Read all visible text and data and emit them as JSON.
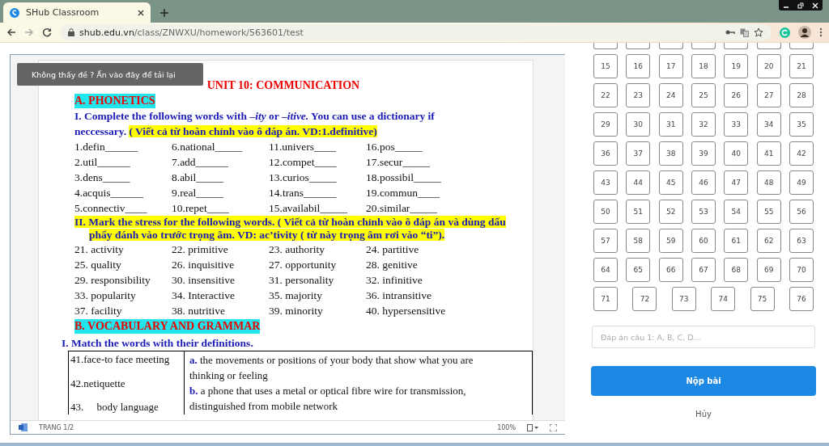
{
  "browser": {
    "tab_title": "SHub Classroom",
    "url_domain": "shub.edu.vn",
    "url_path": "/class/ZNWXU/homework/563601/test"
  },
  "reload_notice": "Không thấy đề ? Ấn vào đây để tải lại",
  "document": {
    "title": "UNIT 10: COMMUNICATION",
    "section_a": "A. PHONETICS",
    "exercise_1": {
      "instruction": "I. Complete the following words with *–ity* or *–itive.* You can use a dictionary if neccessary.",
      "note": "( Viết cả từ hoàn chỉnh vào ô đáp án. VD:1.definitive)",
      "items": [
        "1.defin______",
        "6.national_____",
        "11.univers____",
        "16.pos_____",
        "2.util______",
        "7.add______",
        "12.compet____",
        "17.secur_____",
        "3.dens_____",
        "8.abil_____",
        "13.curios_____",
        "18.possibil_____",
        "4.acquis______",
        "9.real_____",
        "14.trans______",
        "19.commun____",
        "5.connectiv____",
        "10.repet____",
        "15.availabil_____",
        "20.similar_____"
      ]
    },
    "exercise_2": {
      "instruction": "II. Mark the stress for the following words.",
      "note": "( Viết cả từ hoàn chỉnh vào ô đáp án và dùng dấu phẩy đánh vào trước trọng âm. VD: ac’tivity ( từ này trọng âm rơi vào “ti”).",
      "items": [
        "21. activity",
        "22. primitive",
        "23. authority",
        "24. partitive",
        "25. quality",
        "26. inquisitive",
        "27. opportunity",
        "28. genitive",
        "29. responsibility",
        "30. insensitive",
        "31. personality",
        "32. infinitive",
        "33. popularity",
        "34. Interactive",
        "35. majority",
        "36. intransitive",
        "37. facility",
        "38. nutritive",
        "39. minority",
        "40. hypersensitive"
      ]
    },
    "section_b": "B. VOCABULARY AND GRAMMAR",
    "exercise_3": {
      "instruction": "I. Match the words with their definitions.",
      "words": [
        "41.face-to face meeting",
        "42.netiquette",
        "43.     body language"
      ],
      "definitions": [
        "**a.** the movements or positions of your body that show what you are thinking or feeling",
        "**b.** a phone that uses a metal or optical fibre wire for transmission, distinguished from mobile network"
      ]
    }
  },
  "viewer_status": {
    "page": "TRANG 1/2",
    "zoom": "100%"
  },
  "question_numbers": [
    "15",
    "16",
    "17",
    "18",
    "19",
    "20",
    "21",
    "22",
    "23",
    "24",
    "25",
    "26",
    "27",
    "28",
    "29",
    "30",
    "31",
    "32",
    "33",
    "34",
    "35",
    "36",
    "37",
    "38",
    "39",
    "40",
    "41",
    "42",
    "43",
    "44",
    "45",
    "46",
    "47",
    "48",
    "49",
    "50",
    "51",
    "52",
    "53",
    "54",
    "55",
    "56",
    "57",
    "58",
    "59",
    "60",
    "61",
    "62",
    "63",
    "64",
    "65",
    "66",
    "67",
    "68",
    "69",
    "70",
    "71",
    "72",
    "73",
    "74",
    "75",
    "76"
  ],
  "answer_field": {
    "placeholder": "Đáp án câu 1: A, B, C, D..."
  },
  "submit_button": "Nộp bài",
  "cancel_link": "Hủy"
}
